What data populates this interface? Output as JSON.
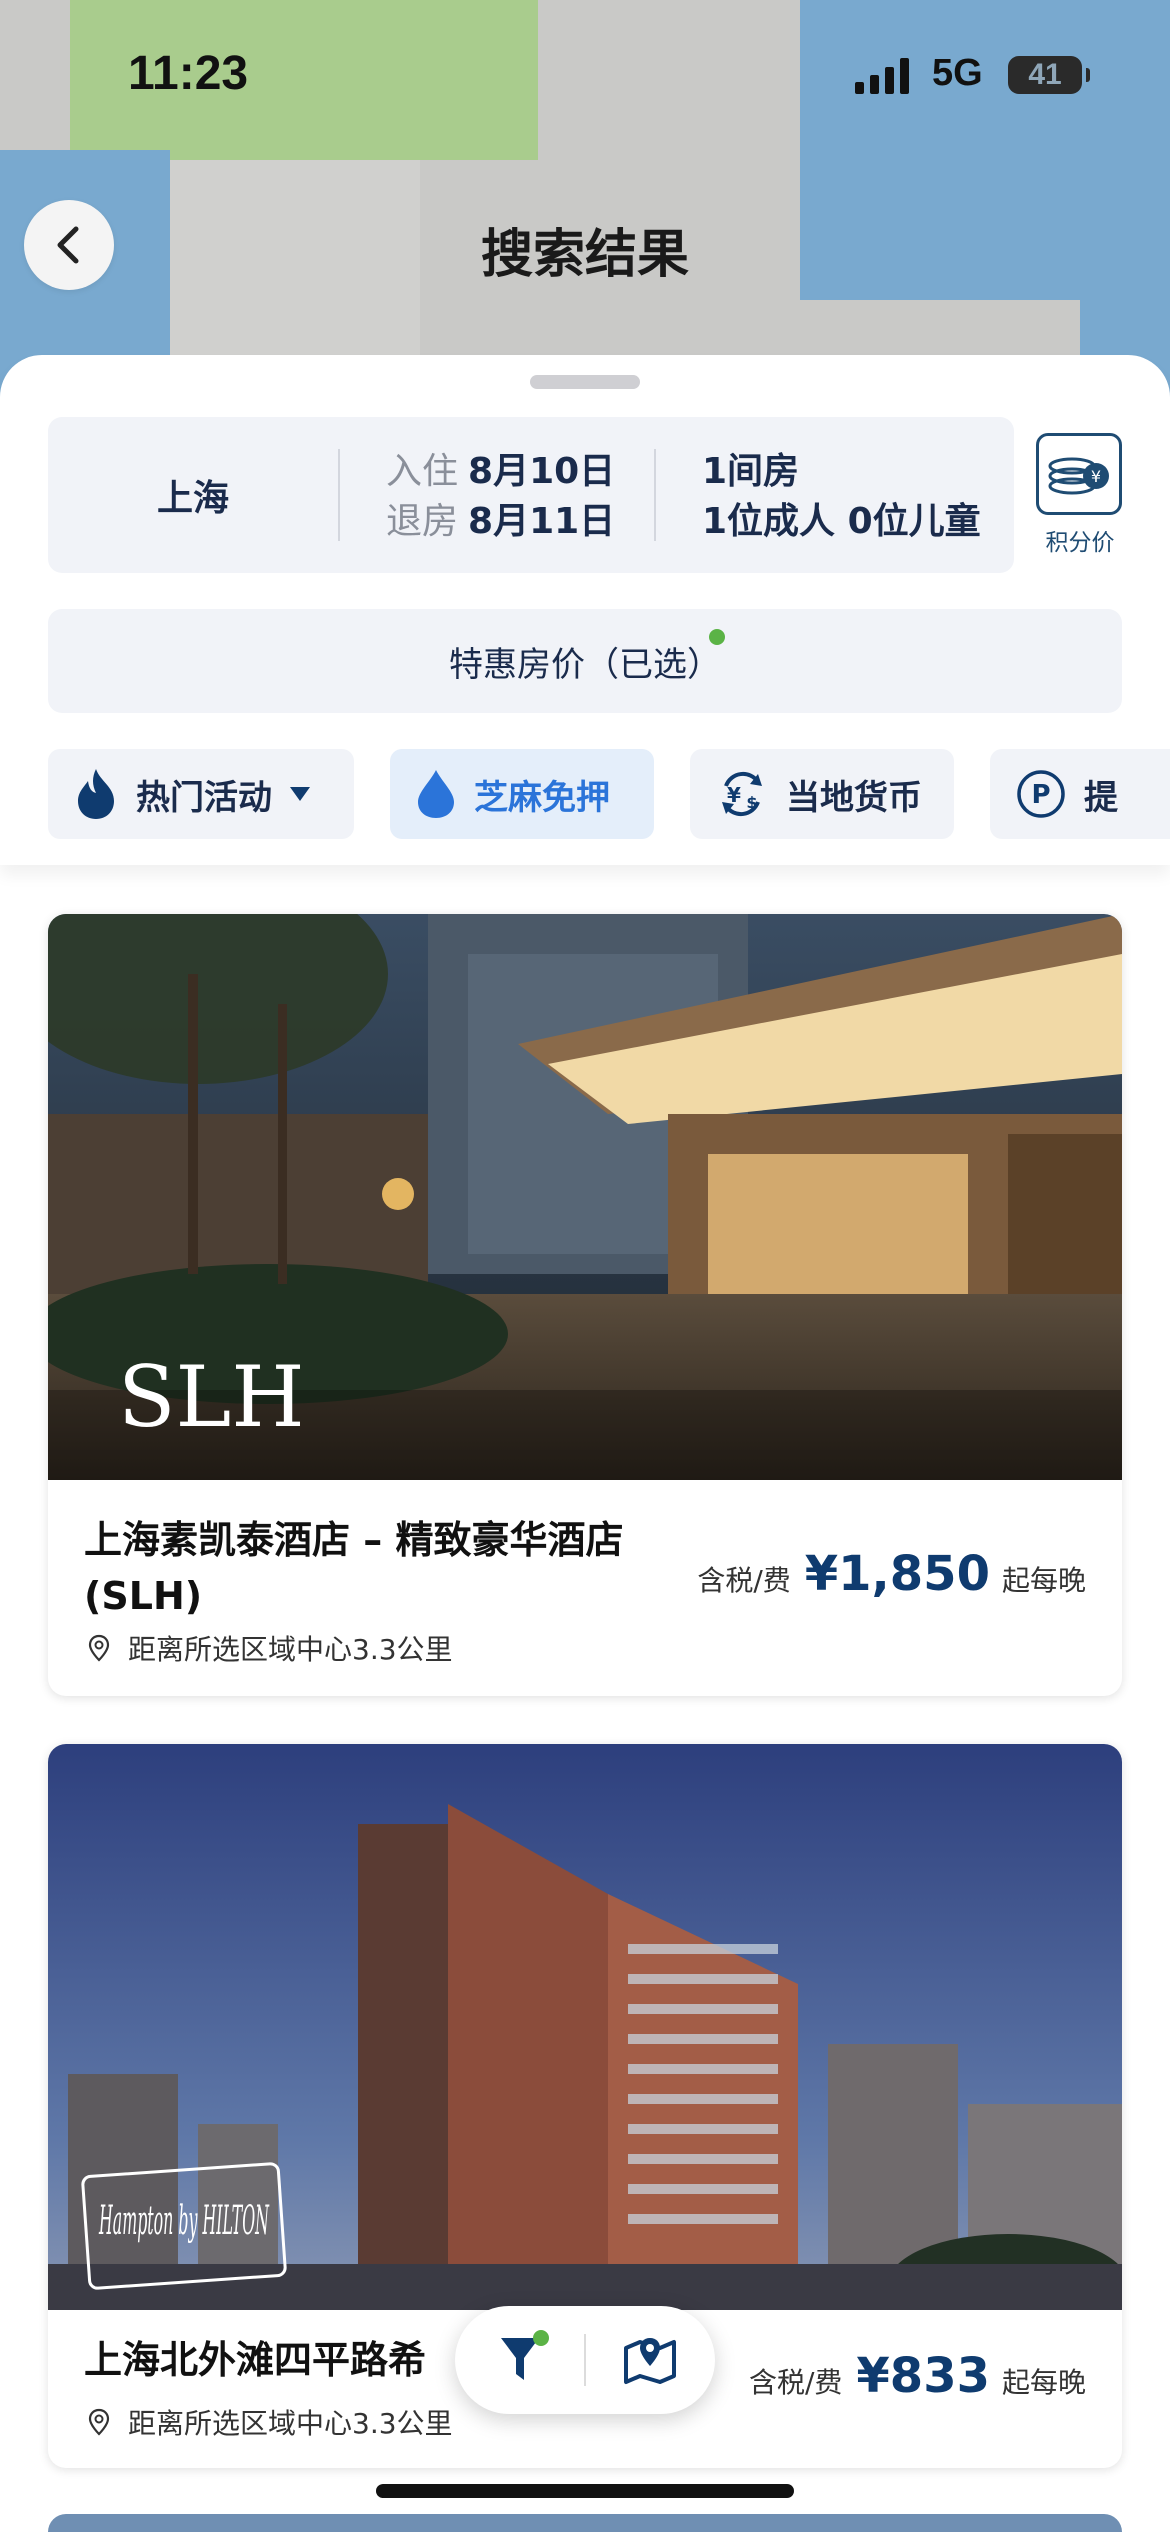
{
  "status_bar": {
    "time": "11:23",
    "network": "5G",
    "battery": "41"
  },
  "header": {
    "title": "搜索结果"
  },
  "search": {
    "city": "上海",
    "checkin_label": "入住",
    "checkin_date": "8月10日",
    "checkout_label": "退房",
    "checkout_date": "8月11日",
    "rooms": "1间房",
    "guests": "1位成人 0位儿童",
    "points_label": "积分价"
  },
  "promo": {
    "label": "特惠房价（已选）"
  },
  "filters": [
    {
      "label": "热门活动",
      "icon": "flame-icon"
    },
    {
      "label": "芝麻免押",
      "icon": "droplet-icon",
      "active": true
    },
    {
      "label": "当地货币",
      "icon": "currency-exchange-icon"
    },
    {
      "label": "提",
      "icon": "parking-icon"
    }
  ],
  "hotels": [
    {
      "name": "上海素凯泰酒店 – 精致豪华酒店 (SLH)",
      "brand": "SLH",
      "distance": "距离所选区域中心3.3公里",
      "tax_label": "含税/费",
      "price": "¥1,850",
      "per_night": "起每晚"
    },
    {
      "name": "上海北外滩四平路希",
      "brand": "Hampton by HILTON",
      "distance": "距离所选区域中心3.3公里",
      "tax_label": "含税/费",
      "price": "¥833",
      "per_night": "起每晚"
    }
  ],
  "colors": {
    "accent": "#0f3b6f",
    "active_chip": "#2b74d9",
    "indicator_dot": "#5bb346"
  }
}
